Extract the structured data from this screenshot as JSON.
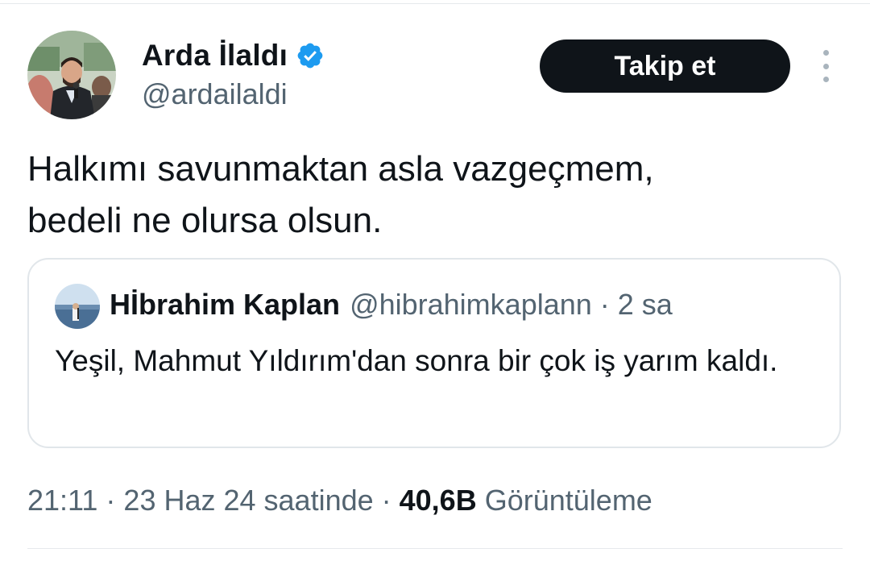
{
  "author": {
    "display_name": "Arda İlaldı",
    "handle": "@ardailaldi",
    "verified": true
  },
  "actions": {
    "follow_label": "Takip et",
    "more_icon": "more-vertical-icon"
  },
  "tweet": {
    "text": "Halkımı savunmaktan asla vazgeçmem,\nbedeli ne olursa olsun."
  },
  "quoted_tweet": {
    "display_name": "Hİbrahim Kaplan",
    "handle": "@hibrahimkaplann",
    "separator": "·",
    "time": "2 sa",
    "text": "Yeşil, Mahmut Yıldırım'dan sonra bir çok iş yarım kaldı."
  },
  "meta": {
    "time": "21:11",
    "separator": "·",
    "date": "23 Haz 24 saatinde",
    "views_count": "40,6B",
    "views_label": "Görüntüleme"
  },
  "colors": {
    "text_primary": "#0f1419",
    "text_secondary": "#536471",
    "verified_blue": "#1d9bf0",
    "button_dark": "#0f1419",
    "divider": "#e6e9ec"
  }
}
